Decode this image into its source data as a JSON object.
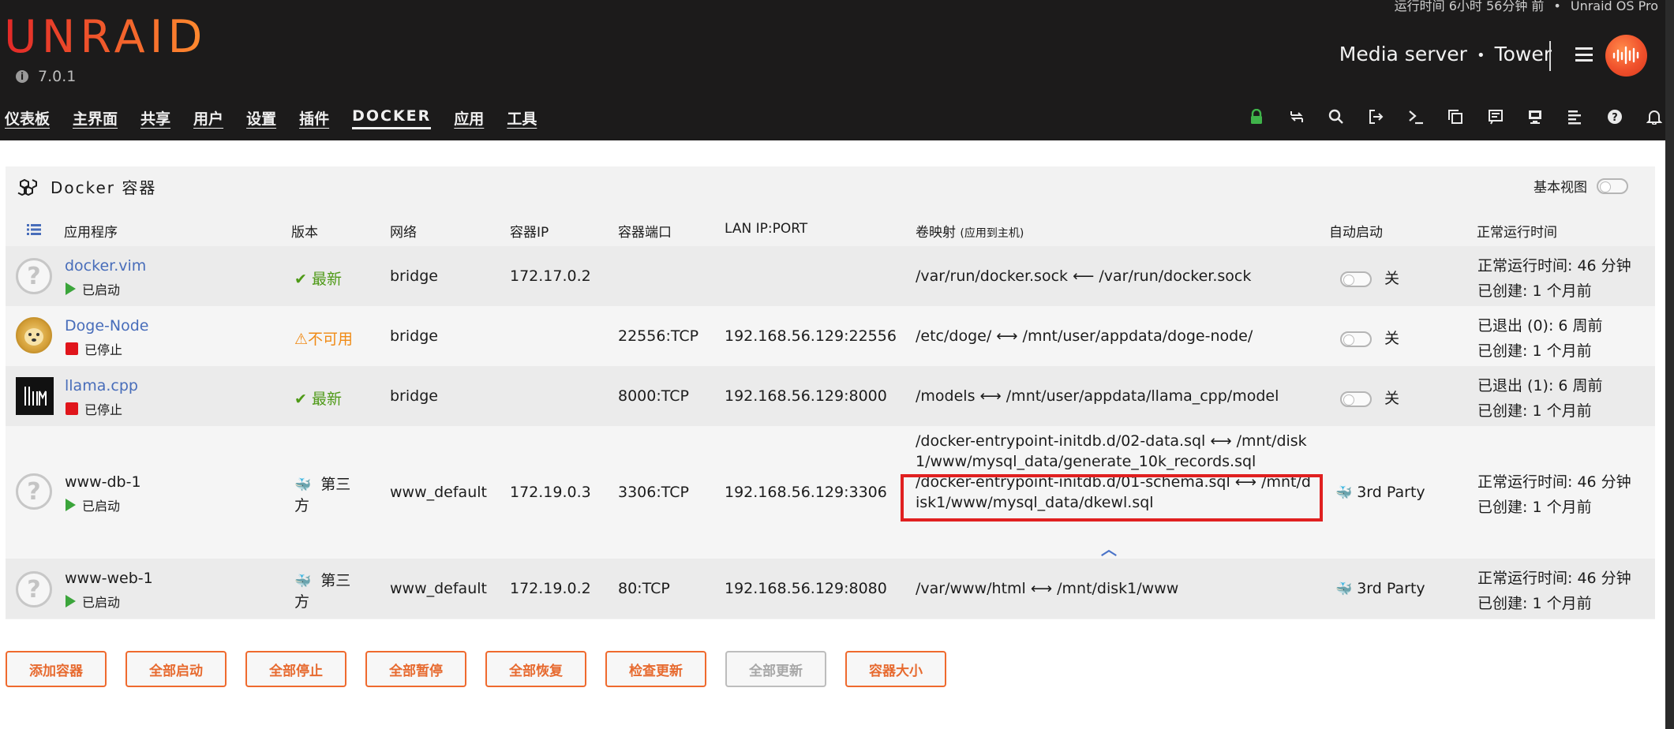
{
  "header": {
    "top_info": "运行时间 6小时 56分钟 前",
    "top_edition": "Unraid OS Pro",
    "logo": "UNRAID",
    "version": "7.0.1",
    "server_description": "Media server",
    "server_name": "Tower",
    "nav": [
      {
        "label": "仪表板"
      },
      {
        "label": "主界面"
      },
      {
        "label": "共享"
      },
      {
        "label": "用户"
      },
      {
        "label": "设置"
      },
      {
        "label": "插件"
      },
      {
        "label": "DOCKER",
        "active": true
      },
      {
        "label": "应用"
      },
      {
        "label": "工具"
      }
    ],
    "nav_icons": [
      "lock-icon",
      "refresh-icon",
      "search-icon",
      "logout-icon",
      "terminal-icon",
      "copy-icon",
      "notes-icon",
      "monitor-icon",
      "log-icon",
      "help-icon",
      "bell-icon"
    ]
  },
  "panel": {
    "title": "Docker 容器",
    "basic_view_label": "基本视图"
  },
  "table": {
    "columns": {
      "app": "应用程序",
      "version": "版本",
      "network": "网络",
      "container_ip": "容器IP",
      "container_port": "容器端口",
      "lan_ip_port": "LAN IP:PORT",
      "volume_mapping": "卷映射",
      "volume_mapping_hint": "(应用到主机)",
      "autostart": "自动启动",
      "uptime": "正常运行时间"
    },
    "rows": [
      {
        "name": "docker.vim",
        "icon": "question-icon",
        "status": "已启动",
        "version": "最新",
        "network": "bridge",
        "ip": "172.17.0.2",
        "port": "",
        "lan": "",
        "mapping": "/var/run/docker.sock ⟵ /var/run/docker.sock",
        "autostart": "关",
        "uptime1": "正常运行时间: 46 分钟",
        "uptime2": "已创建: 1 个月前"
      },
      {
        "name": "Doge-Node",
        "icon": "doge-icon",
        "status": "已停止",
        "version": "不可用",
        "network": "bridge",
        "ip": "",
        "port": "22556:TCP",
        "lan": "192.168.56.129:22556",
        "mapping": "/etc/doge/ ⟷ /mnt/user/appdata/doge-node/",
        "autostart": "关",
        "uptime1": "已退出 (0): 6 周前",
        "uptime2": "已创建: 1 个月前"
      },
      {
        "name": "llama.cpp",
        "icon": "llama-icon",
        "status": "已停止",
        "version": "最新",
        "network": "bridge",
        "ip": "",
        "port": "8000:TCP",
        "lan": "192.168.56.129:8000",
        "mapping": "/models ⟷ /mnt/user/appdata/llama_cpp/model",
        "autostart": "关",
        "uptime1": "已退出 (1): 6 周前",
        "uptime2": "已创建: 1 个月前"
      },
      {
        "name": "www-db-1",
        "icon": "question-icon",
        "status": "已启动",
        "version_line1": "第三",
        "version_line2": "方",
        "network": "www_default",
        "ip": "172.19.0.3",
        "port": "3306:TCP",
        "lan": "192.168.56.129:3306",
        "mapping_lines": [
          "/docker-entrypoint-initdb.d/02-data.sql ⟷ /mnt/disk",
          "1/www/mysql_data/generate_10k_records.sql",
          "/docker-entrypoint-initdb.d/01-schema.sql ⟷ /mnt/d",
          "isk1/www/mysql_data/dkewl.sql"
        ],
        "autostart": "3rd Party",
        "uptime1": "正常运行时间: 46 分钟",
        "uptime2": "已创建: 1 个月前"
      },
      {
        "name": "www-web-1",
        "icon": "question-icon",
        "status": "已启动",
        "version_line1": "第三",
        "version_line2": "方",
        "network": "www_default",
        "ip": "172.19.0.2",
        "port": "80:TCP",
        "lan": "192.168.56.129:8080",
        "mapping": "/var/www/html ⟷ /mnt/disk1/www",
        "autostart": "3rd Party",
        "uptime1": "正常运行时间: 46 分钟",
        "uptime2": "已创建: 1 个月前"
      }
    ]
  },
  "buttons": [
    {
      "label": "添加容器",
      "enabled": true
    },
    {
      "label": "全部启动",
      "enabled": true
    },
    {
      "label": "全部停止",
      "enabled": true
    },
    {
      "label": "全部暂停",
      "enabled": true
    },
    {
      "label": "全部恢复",
      "enabled": true
    },
    {
      "label": "检查更新",
      "enabled": true
    },
    {
      "label": "全部更新",
      "enabled": false
    },
    {
      "label": "容器大小",
      "enabled": true
    }
  ],
  "colors": {
    "header_bg": "#1c1b1b",
    "accent_orange": "#ef6a2e",
    "link_blue": "#486dba",
    "ok_green": "#4f9a18",
    "stop_red": "#e0151b",
    "highlight_red": "#e02020"
  }
}
